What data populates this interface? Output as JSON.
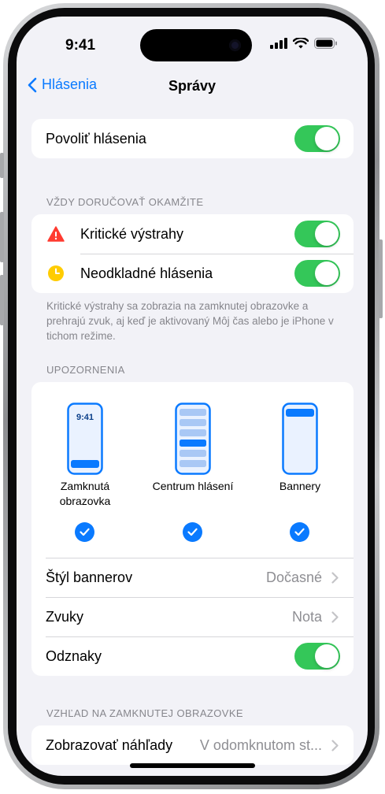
{
  "status_bar": {
    "time": "9:41"
  },
  "nav": {
    "back_label": "Hlásenia",
    "title": "Správy"
  },
  "allow": {
    "label": "Povoliť hlásenia",
    "on": true
  },
  "immediate": {
    "header": "VŽDY DORUČOVAŤ OKAMŽITE",
    "items": [
      {
        "label": "Kritické výstrahy",
        "icon": "warning-triangle-icon",
        "icon_color": "#ff3b30",
        "on": true
      },
      {
        "label": "Neodkladné hlásenia",
        "icon": "clock-icon",
        "icon_color": "#ffcc00",
        "on": true
      }
    ],
    "footnote": "Kritické výstrahy sa zobrazia na zamknutej obrazovke a prehrajú zvuk, aj keď je aktivovaný Môj čas alebo je iPhone v tichom režime."
  },
  "alerts": {
    "header": "UPOZORNENIA",
    "lock_preview_time": "9:41",
    "options": [
      {
        "label_line1": "Zamknutá",
        "label_line2": "obrazovka",
        "checked": true
      },
      {
        "label_line1": "Centrum hlásení",
        "label_line2": "",
        "checked": true
      },
      {
        "label_line1": "Bannery",
        "label_line2": "",
        "checked": true
      }
    ],
    "banner_style": {
      "label": "Štýl bannerov",
      "value": "Dočasné"
    },
    "sounds": {
      "label": "Zvuky",
      "value": "Nota"
    },
    "badges": {
      "label": "Odznaky",
      "on": true
    }
  },
  "lock_screen": {
    "header": "VZHĽAD NA ZAMKNUTEJ OBRAZOVKE",
    "previews": {
      "label": "Zobrazovať náhľady",
      "value": "V odomknutom st..."
    }
  },
  "colors": {
    "accent": "#0a7aff",
    "toggle_on": "#34c759",
    "background": "#f2f2f7"
  }
}
